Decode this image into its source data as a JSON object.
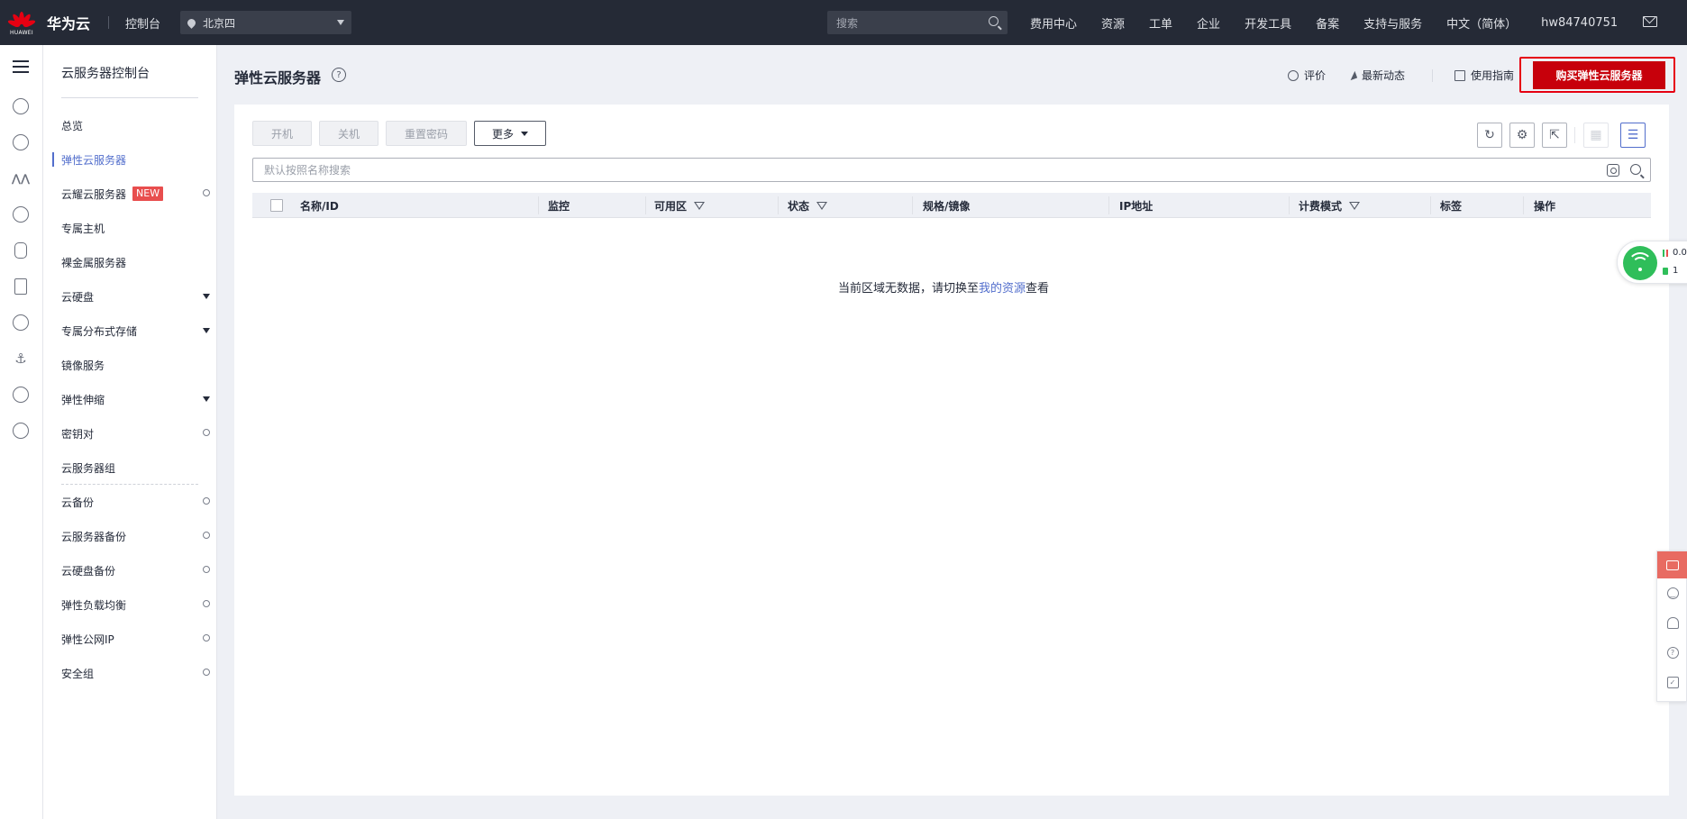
{
  "topbar": {
    "brand": "华为云",
    "logo_text": "HUAWEI",
    "console": "控制台",
    "region": "北京四",
    "search_placeholder": "搜索",
    "nav": [
      "费用中心",
      "资源",
      "工单",
      "企业",
      "开发工具",
      "备案",
      "支持与服务",
      "中文（简体）",
      "hw84740751"
    ]
  },
  "sidemenu": {
    "title": "云服务器控制台",
    "items": [
      {
        "label": "总览"
      },
      {
        "label": "弹性云服务器",
        "active": true
      },
      {
        "label": "云耀云服务器",
        "badge": "NEW"
      },
      {
        "label": "专属主机"
      },
      {
        "label": "裸金属服务器"
      },
      {
        "label": "云硬盘"
      },
      {
        "label": "专属分布式存储"
      },
      {
        "label": "镜像服务"
      },
      {
        "label": "弹性伸缩"
      },
      {
        "label": "密钥对"
      },
      {
        "label": "云服务器组"
      },
      {
        "label": "云备份"
      },
      {
        "label": "云服务器备份"
      },
      {
        "label": "云硬盘备份"
      },
      {
        "label": "弹性负载均衡"
      },
      {
        "label": "弹性公网IP"
      },
      {
        "label": "安全组"
      }
    ]
  },
  "header": {
    "title": "弹性云服务器",
    "rate": "评价",
    "news": "最新动态",
    "guide": "使用指南",
    "buy": "购买弹性云服务器"
  },
  "toolbar": {
    "start": "开机",
    "stop": "关机",
    "reset_password": "重置密码",
    "more": "更多"
  },
  "search": {
    "placeholder": "默认按照名称搜索"
  },
  "table": {
    "columns": [
      "名称/ID",
      "监控",
      "可用区",
      "状态",
      "规格/镜像",
      "IP地址",
      "计费模式",
      "标签",
      "操作"
    ],
    "empty_prefix": "当前区域无数据，请切换至",
    "empty_link": "我的资源",
    "empty_suffix": "查看"
  },
  "network_widget": {
    "speed": "0.0",
    "count": "1"
  },
  "colors": {
    "topbar_bg": "#252a36",
    "accent": "#526ecc",
    "buy_button": "#c7000b",
    "highlight_outline": "#e60012"
  }
}
